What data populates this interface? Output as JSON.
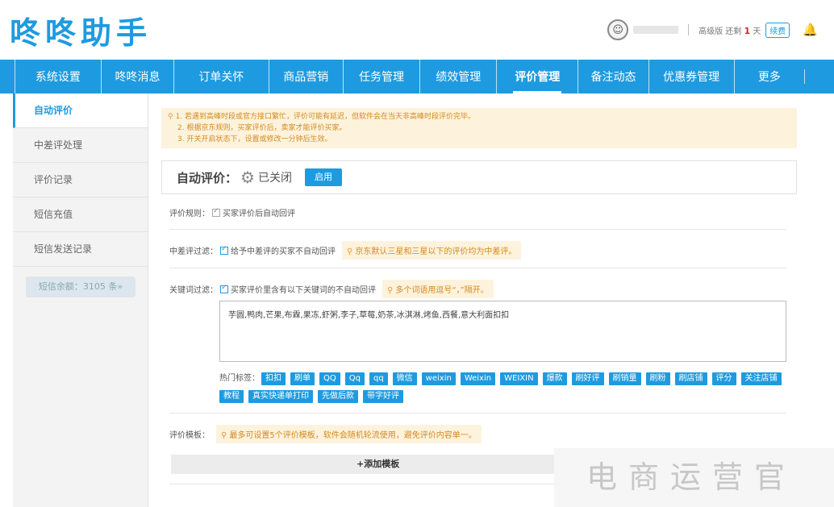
{
  "header": {
    "logo": "咚咚助手",
    "version_prefix": "高级版 还剩",
    "days_left": "1",
    "days_unit": "天",
    "renew_label": "续费",
    "avatar_icon": "user-avatar-icon",
    "bell_icon": "bell-icon"
  },
  "nav": {
    "items": [
      "系统设置",
      "咚咚消息",
      "订单关怀",
      "商品营销",
      "任务管理",
      "绩效管理",
      "评价管理",
      "备注动态",
      "优惠券管理",
      "更多"
    ],
    "active_index": 6
  },
  "sidebar": {
    "items": [
      "自动评价",
      "中差评处理",
      "评价记录",
      "短信充值",
      "短信发送记录"
    ],
    "active_index": 0,
    "sms_balance": "短信余额：3105 条»"
  },
  "notice": {
    "line1": "1. 若遇到高峰时段或官方接口繁忙，评价可能有延迟，但软件会在当天非高峰时段评价完毕。",
    "line2": "2. 根据京东规则，买家评价后，卖家才能评价买家。",
    "line3": "3. 开关开启状态下，设置或修改一分钟后生效。"
  },
  "status": {
    "title": "自动评价：",
    "value": "已关闭",
    "enable_label": "启用"
  },
  "rules": {
    "rule_label": "评价规则：",
    "rule_text": "买家评价后自动回评",
    "bad_filter_label": "中差评过滤：",
    "bad_filter_text": "给予中差评的买家不自动回评",
    "bad_filter_tip": "京东默认三星和三星以下的评价均为中差评。",
    "keyword_label": "关键词过滤：",
    "keyword_text": "买家评价里含有以下关键词的不自动回评",
    "keyword_tip": "多个词语用逗号“，”隔开。",
    "keywords": "芋圆,鸭肉,芒果,布霖,果冻,虾粥,李子,草莓,奶茶,冰淇淋,烤鱼,西餐,意大利面扣扣",
    "hot_label": "热门标签：",
    "hot_tags": [
      "扣扣",
      "刷单",
      "QQ",
      "Qq",
      "qq",
      "微信",
      "weixin",
      "Weixin",
      "WEIXIN",
      "爆款",
      "刷好评",
      "刷销量",
      "刷粉",
      "刷店铺",
      "评分",
      "关注店铺",
      "教程",
      "真实快递单打印",
      "先做后款",
      "带字好评"
    ],
    "template_label": "评价模板：",
    "template_tip": "最多可设置5个评价模板，软件会随机轮流使用，避免评价内容单一。",
    "add_template_label": "+添加模板"
  },
  "watermark": "电商运营官"
}
